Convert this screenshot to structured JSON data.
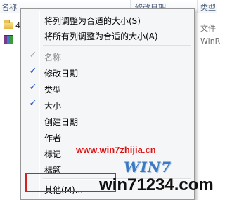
{
  "explorer": {
    "columns": {
      "name": "名称",
      "date_modified": "修改日期",
      "type": "类型"
    },
    "bg_type_1": "文件",
    "bg_type_2": "WinR",
    "row_fragment": "4"
  },
  "context_menu": {
    "size_actions": [
      {
        "label": "将列调整为合适的大小(S)"
      },
      {
        "label": "将所有列调整为合适的大小(A)"
      }
    ],
    "columns": [
      {
        "label": "名称",
        "checked": true,
        "disabled": true
      },
      {
        "label": "修改日期",
        "checked": true,
        "disabled": false
      },
      {
        "label": "类型",
        "checked": true,
        "disabled": false
      },
      {
        "label": "大小",
        "checked": true,
        "disabled": false
      },
      {
        "label": "创建日期",
        "checked": false,
        "disabled": false
      },
      {
        "label": "作者",
        "checked": false,
        "disabled": false
      },
      {
        "label": "标记",
        "checked": false,
        "disabled": false
      },
      {
        "label": "标题",
        "checked": false,
        "disabled": false
      }
    ],
    "more": {
      "label": "其他(M)..."
    },
    "check_glyph": "✓"
  },
  "watermarks": {
    "url": "www.win7zhijia.cn",
    "logo": "WIN7",
    "site": "win71234.com"
  },
  "colors": {
    "check": "#2a52be",
    "highlight_box": "#d42020",
    "url_watermark": "#e01010"
  }
}
